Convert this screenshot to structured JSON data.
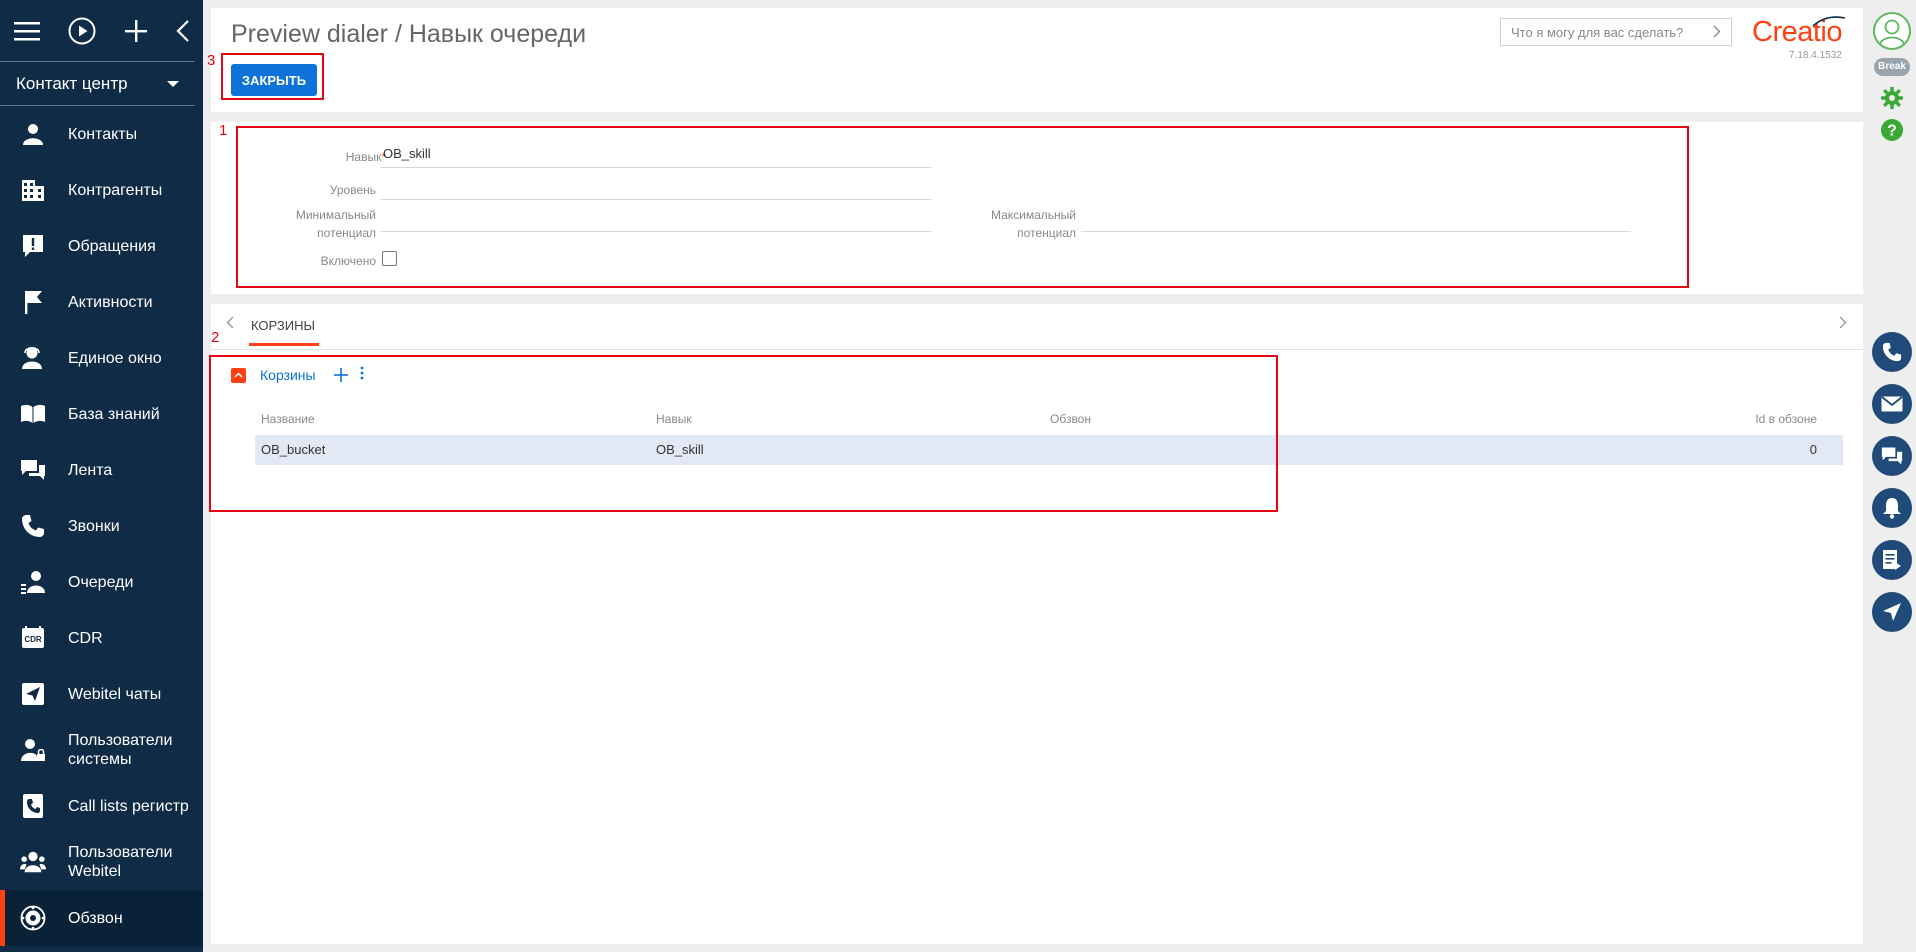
{
  "sidebar": {
    "section": "Контакт центр",
    "items": [
      {
        "label": "Контакты",
        "icon": "person-icon"
      },
      {
        "label": "Контрагенты",
        "icon": "building-icon"
      },
      {
        "label": "Обращения",
        "icon": "alert-icon"
      },
      {
        "label": "Активности",
        "icon": "flag-icon"
      },
      {
        "label": "Единое окно",
        "icon": "agent-icon"
      },
      {
        "label": "База знаний",
        "icon": "book-icon"
      },
      {
        "label": "Лента",
        "icon": "chat-icon"
      },
      {
        "label": "Звонки",
        "icon": "phone-icon"
      },
      {
        "label": "Очереди",
        "icon": "queue-icon"
      },
      {
        "label": "CDR",
        "icon": "cdr-icon"
      },
      {
        "label": "Webitel чаты",
        "icon": "send-icon"
      },
      {
        "label": "Пользователи системы",
        "icon": "user-lock-icon"
      },
      {
        "label": "Call lists регистр",
        "icon": "call-list-icon"
      },
      {
        "label": "Пользователи Webitel",
        "icon": "users-icon"
      },
      {
        "label": "Обзвон",
        "icon": "dialer-icon"
      }
    ]
  },
  "header": {
    "title": "Preview dialer / Навык очереди",
    "close_label": "ЗАКРЫТЬ",
    "search_placeholder": "Что я могу для вас сделать?",
    "logo": "Creatio",
    "version": "7.18.4.1532"
  },
  "form": {
    "skill_label": "Навык",
    "skill_required": "*",
    "skill_value": "OB_skill",
    "level_label": "Уровень",
    "level_value": "",
    "min_label_1": "Минимальный",
    "min_label_2": "потенциал",
    "min_value": "",
    "max_label_1": "Максимальный",
    "max_label_2": "потенциал",
    "max_value": "",
    "enabled_label": "Включено"
  },
  "detail": {
    "tab": "КОРЗИНЫ",
    "group_title": "Корзины",
    "columns": [
      "Название",
      "Навык",
      "Обзвон",
      "Id в обзоне"
    ],
    "rows": [
      {
        "name": "OB_bucket",
        "skill": "OB_skill",
        "dialer": "",
        "id": "0"
      }
    ]
  },
  "annotations": [
    "1",
    "2",
    "3"
  ],
  "rightbar": {
    "status": "Break"
  },
  "colors": {
    "accent": "#ff4013",
    "primary": "#0e72d8",
    "sidebar": "#0f2b46",
    "annotation": "#e30613"
  }
}
